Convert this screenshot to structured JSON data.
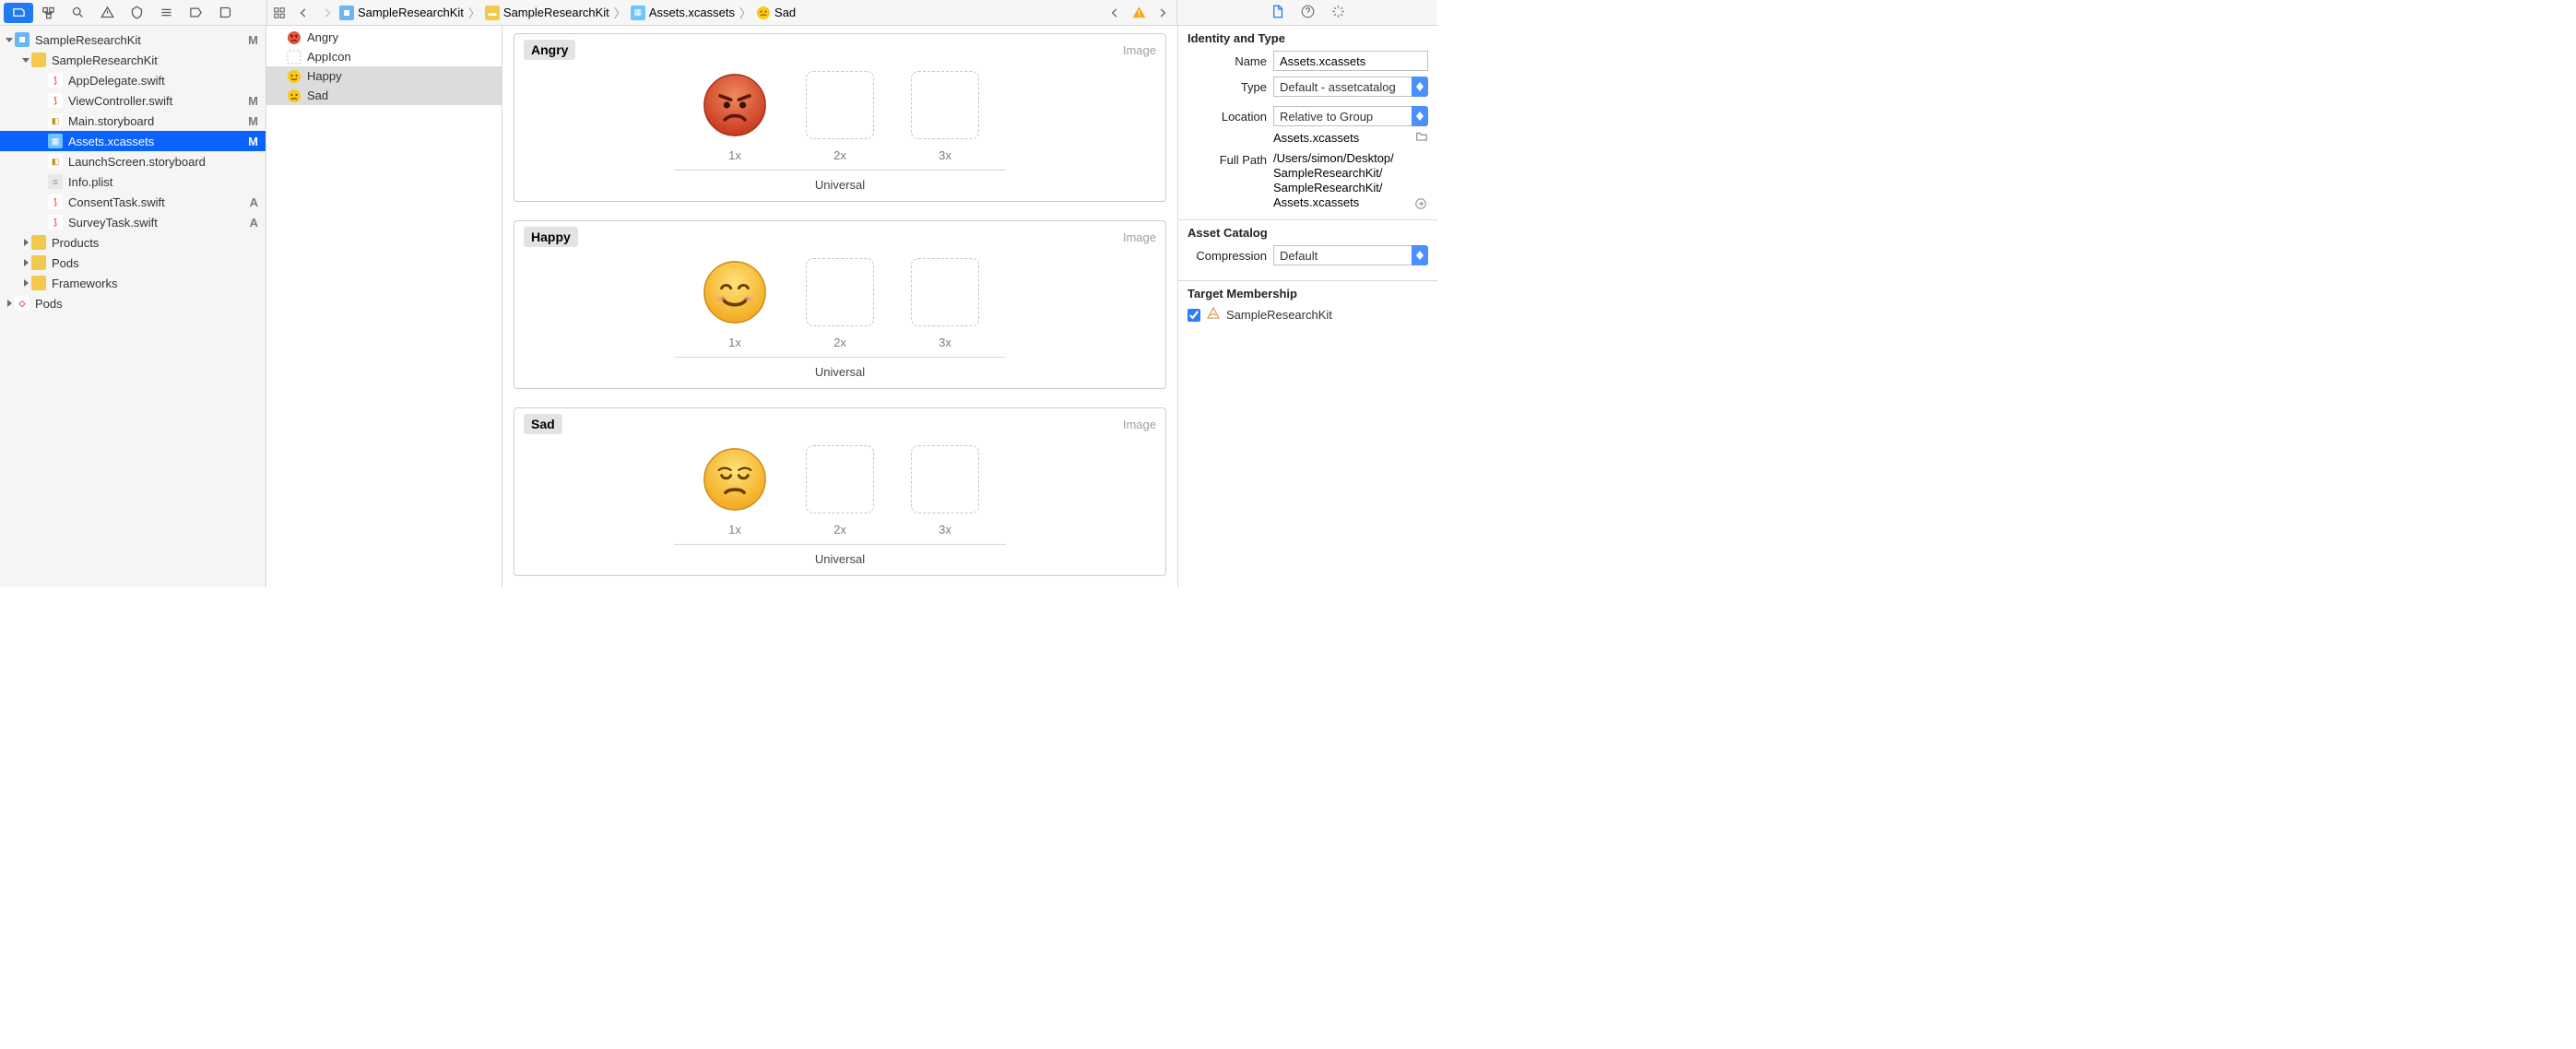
{
  "toolbar": {
    "tabs": [
      "files",
      "scm",
      "search",
      "issues",
      "tests",
      "debug",
      "breakpoints",
      "logs"
    ]
  },
  "crumbs": {
    "items": [
      {
        "label": "SampleResearchKit",
        "icon": "proj"
      },
      {
        "label": "SampleResearchKit",
        "icon": "folder"
      },
      {
        "label": "Assets.xcassets",
        "icon": "assets"
      },
      {
        "label": "Sad",
        "icon": "happy"
      }
    ]
  },
  "nav": {
    "items": [
      {
        "label": "SampleResearchKit",
        "indent": 0,
        "icon": "proj",
        "disclosure": "open",
        "status": "M"
      },
      {
        "label": "SampleResearchKit",
        "indent": 1,
        "icon": "folder",
        "disclosure": "open",
        "status": ""
      },
      {
        "label": "AppDelegate.swift",
        "indent": 2,
        "icon": "swift",
        "status": ""
      },
      {
        "label": "ViewController.swift",
        "indent": 2,
        "icon": "swift",
        "status": "M"
      },
      {
        "label": "Main.storyboard",
        "indent": 2,
        "icon": "story",
        "status": "M"
      },
      {
        "label": "Assets.xcassets",
        "indent": 2,
        "icon": "assets",
        "status": "M",
        "selected": true
      },
      {
        "label": "LaunchScreen.storyboard",
        "indent": 2,
        "icon": "story",
        "status": ""
      },
      {
        "label": "Info.plist",
        "indent": 2,
        "icon": "plist",
        "status": ""
      },
      {
        "label": "ConsentTask.swift",
        "indent": 2,
        "icon": "swift",
        "status": "A"
      },
      {
        "label": "SurveyTask.swift",
        "indent": 2,
        "icon": "swift",
        "status": "A"
      },
      {
        "label": "Products",
        "indent": 1,
        "icon": "folder",
        "disclosure": "closed",
        "status": ""
      },
      {
        "label": "Pods",
        "indent": 1,
        "icon": "folder",
        "disclosure": "closed",
        "status": ""
      },
      {
        "label": "Frameworks",
        "indent": 1,
        "icon": "folder",
        "disclosure": "closed",
        "status": ""
      },
      {
        "label": "Pods",
        "indent": 0,
        "icon": "cocoapods",
        "disclosure": "closed",
        "status": ""
      }
    ]
  },
  "assetList": {
    "items": [
      {
        "label": "Angry",
        "icon": "angry"
      },
      {
        "label": "AppIcon",
        "icon": "appicon"
      },
      {
        "label": "Happy",
        "icon": "happy",
        "sel": true
      },
      {
        "label": "Sad",
        "icon": "sad",
        "sel": true
      }
    ]
  },
  "canvas": {
    "sets": [
      {
        "title": "Angry",
        "kind": "Image",
        "face": "angry",
        "slots": [
          "1x",
          "2x",
          "3x"
        ],
        "caption": "Universal"
      },
      {
        "title": "Happy",
        "kind": "Image",
        "face": "happy",
        "slots": [
          "1x",
          "2x",
          "3x"
        ],
        "caption": "Universal"
      },
      {
        "title": "Sad",
        "kind": "Image",
        "face": "sad",
        "slots": [
          "1x",
          "2x",
          "3x"
        ],
        "caption": "Universal"
      }
    ]
  },
  "inspector": {
    "section1_title": "Identity and Type",
    "name_label": "Name",
    "name_value": "Assets.xcassets",
    "type_label": "Type",
    "type_value": "Default - assetcatalog",
    "location_label": "Location",
    "location_value": "Relative to Group",
    "location_sub": "Assets.xcassets",
    "fullpath_label": "Full Path",
    "fullpath_value": "/Users/simon/Desktop/SampleResearchKit/SampleResearchKit/Assets.xcassets",
    "section2_title": "Asset Catalog",
    "compression_label": "Compression",
    "compression_value": "Default",
    "section3_title": "Target Membership",
    "member_label": "SampleResearchKit"
  }
}
